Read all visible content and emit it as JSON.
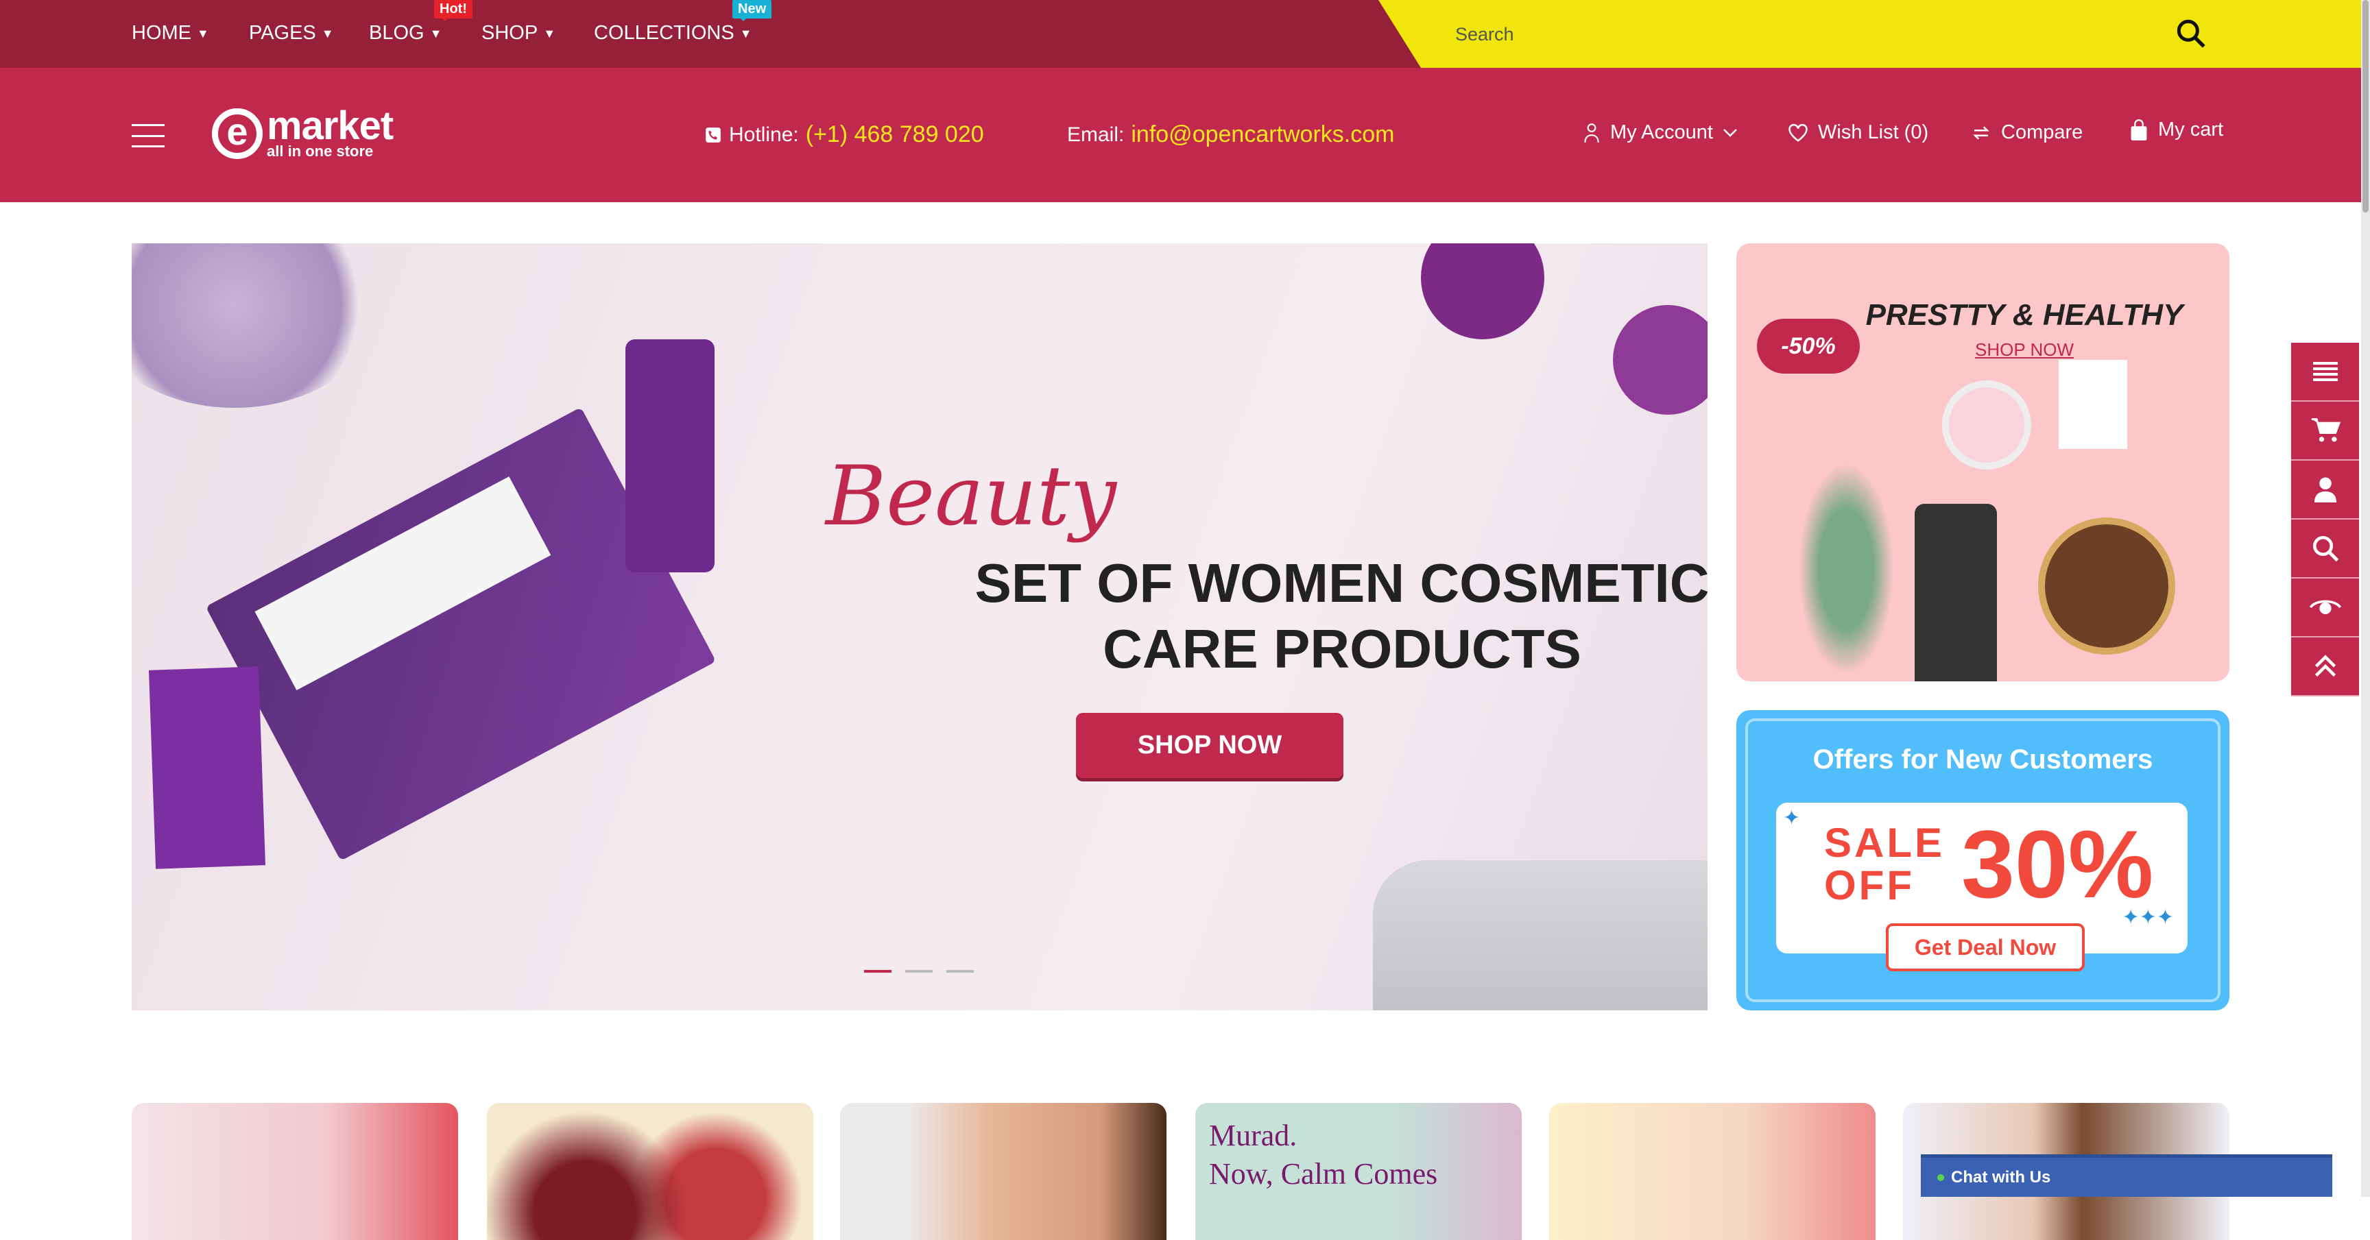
{
  "nav": {
    "items": [
      {
        "label": "HOME"
      },
      {
        "label": "PAGES"
      },
      {
        "label": "BLOG",
        "badge": "Hot!"
      },
      {
        "label": "SHOP"
      },
      {
        "label": "COLLECTIONS",
        "badge": "New"
      }
    ],
    "search_placeholder": "Search"
  },
  "header": {
    "logo_main": "market",
    "logo_sub": "all in one store",
    "hotline_label": "Hotline:",
    "hotline_value": "(+1) 468 789 020",
    "email_label": "Email:",
    "email_value": "info@opencartworks.com",
    "my_account": "My Account",
    "wish_list": "Wish List (0)",
    "compare": "Compare",
    "my_cart": "My cart"
  },
  "hero": {
    "script": "Beauty",
    "title_line1": "SET OF WOMEN COSMETIC",
    "title_line2": "CARE PRODUCTS",
    "button": "SHOP NOW",
    "slides": 3,
    "active_slide": 1
  },
  "banner1": {
    "title": "PRESTTY & HEALTHY",
    "link": "SHOP NOW",
    "badge": "-50%"
  },
  "banner2": {
    "title": "Offers for New Customers",
    "sale": "SALE",
    "off": "OFF",
    "percent": "30%",
    "button": "Get Deal Now"
  },
  "side_toolbar": [
    "menu-icon",
    "cart-icon",
    "user-icon",
    "search-icon",
    "eye-icon",
    "scroll-top-icon"
  ],
  "tiles": [
    {
      "text": ""
    },
    {
      "text": ""
    },
    {
      "text": ""
    },
    {
      "brand": "Murad.",
      "text": "Now, Calm Comes"
    },
    {
      "text": ""
    },
    {
      "text": ""
    }
  ],
  "chat": {
    "label": "Chat with Us"
  },
  "colors": {
    "topbar": "#962039",
    "header": "#c0284d",
    "search": "#f1e60b",
    "accent_yellow": "#f8e71c",
    "offer_blue": "#52bdfb"
  }
}
